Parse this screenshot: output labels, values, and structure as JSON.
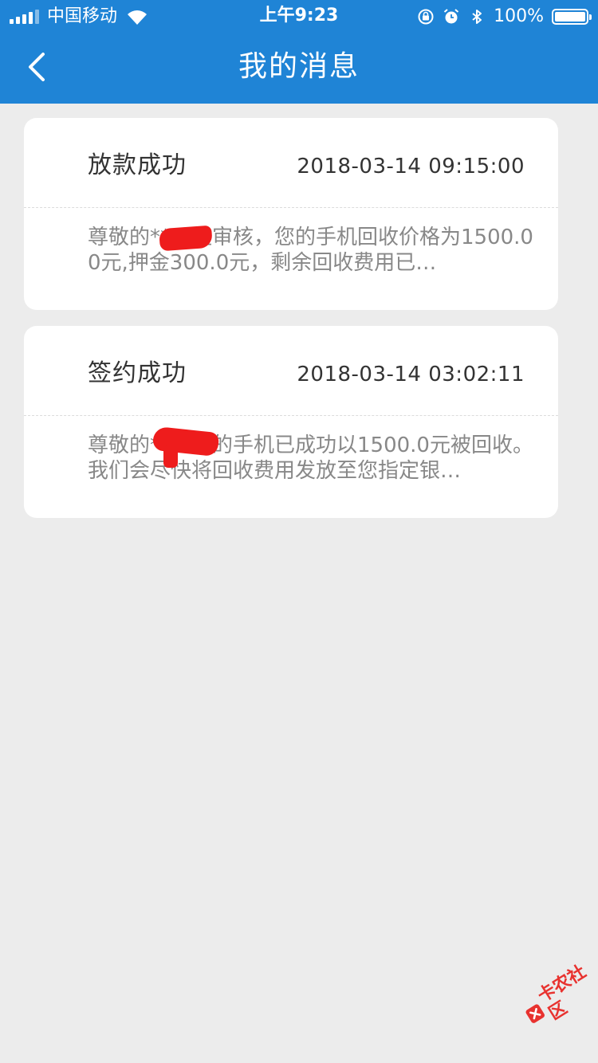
{
  "status_bar": {
    "carrier": "中国移动",
    "time": "上午9:23",
    "battery": "100%",
    "icons": [
      "signal-icon",
      "wifi-icon",
      "rotation-lock-icon",
      "alarm-icon",
      "bluetooth-icon",
      "battery-icon"
    ]
  },
  "nav": {
    "title": "我的消息",
    "back_icon": "chevron-left-icon"
  },
  "messages": [
    {
      "title": "放款成功",
      "time": "2018-03-14 09:15:00",
      "body": "尊敬的**，经审核，您的手机回收价格为1500.00元,押金300.0元，剩余回收费用已…"
    },
    {
      "title": "签约成功",
      "time": "2018-03-14 03:02:11",
      "body": "尊敬的**，您的手机已成功以1500.0元被回收。我们会尽快将回收费用发放至您指定银…"
    }
  ],
  "watermark": {
    "text": "卡农社区"
  },
  "colors": {
    "header": "#1f84d6",
    "background": "#ececec",
    "card": "#ffffff",
    "title_text": "#333333",
    "body_text": "#888888",
    "redaction": "#ee1c1c",
    "watermark": "#e8322f"
  }
}
